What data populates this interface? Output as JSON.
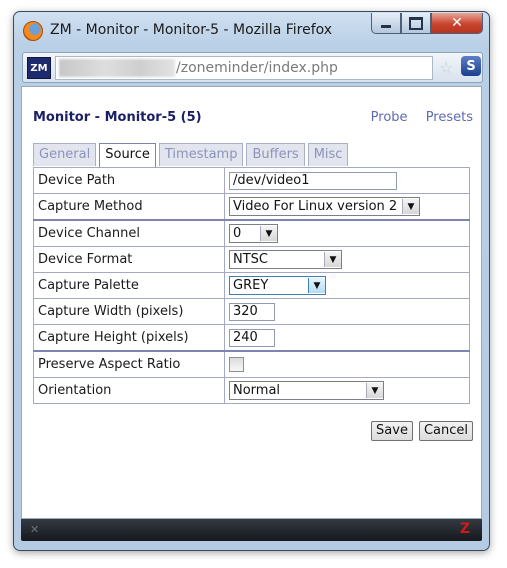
{
  "window": {
    "title": "ZM - Monitor - Monitor-5 - Mozilla Firefox",
    "min_icon": "minimize-icon",
    "max_icon": "maximize-icon",
    "close_icon": "close-icon",
    "close_label": "✕"
  },
  "addressbar": {
    "site_badge": "ZM",
    "url_visible": "/zoneminder/index.php",
    "star_icon": "bookmark-star-icon",
    "ext_label": "S"
  },
  "page": {
    "title": "Monitor - Monitor-5 (5)",
    "links": [
      "Probe",
      "Presets"
    ]
  },
  "tabs": [
    {
      "label": "General",
      "active": false
    },
    {
      "label": "Source",
      "active": true
    },
    {
      "label": "Timestamp",
      "active": false
    },
    {
      "label": "Buffers",
      "active": false
    },
    {
      "label": "Misc",
      "active": false
    }
  ],
  "form": {
    "device_path": {
      "label": "Device Path",
      "value": "/dev/video1"
    },
    "capture_method": {
      "label": "Capture Method",
      "value": "Video For Linux version 2"
    },
    "device_channel": {
      "label": "Device Channel",
      "value": "0"
    },
    "device_format": {
      "label": "Device Format",
      "value": "NTSC"
    },
    "capture_palette": {
      "label": "Capture Palette",
      "value": "GREY"
    },
    "capture_width": {
      "label": "Capture Width (pixels)",
      "value": "320"
    },
    "capture_height": {
      "label": "Capture Height (pixels)",
      "value": "240"
    },
    "preserve_aspect": {
      "label": "Preserve Aspect Ratio",
      "checked": false
    },
    "orientation": {
      "label": "Orientation",
      "value": "Normal"
    }
  },
  "buttons": {
    "save": "Save",
    "cancel": "Cancel"
  },
  "statusbar": {
    "left_icon": "x-icon",
    "right_icon": "zoneminder-z-icon"
  }
}
